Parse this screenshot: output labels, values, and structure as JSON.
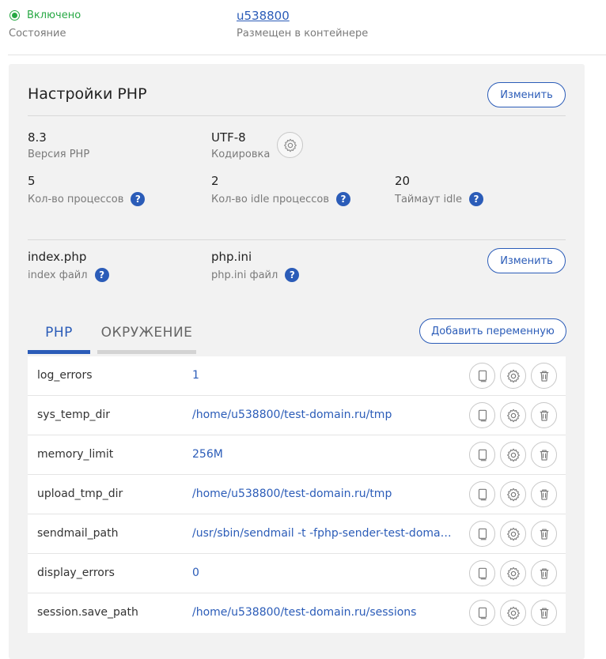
{
  "status": {
    "label": "Включено",
    "caption": "Состояние"
  },
  "container": {
    "user": "u538800",
    "caption": "Размещен в контейнере"
  },
  "php_settings": {
    "title": "Настройки PHP",
    "change_label": "Изменить",
    "version": {
      "value": "8.3",
      "label": "Версия PHP"
    },
    "encoding": {
      "value": "UTF-8",
      "label": "Кодировка",
      "icon": "gear-icon"
    },
    "processes": {
      "value": "5",
      "label": "Кол-во процессов"
    },
    "idle_processes": {
      "value": "2",
      "label": "Кол-во idle процессов"
    },
    "idle_timeout": {
      "value": "20",
      "label": "Таймаут idle"
    },
    "help_glyph": "?"
  },
  "files": {
    "index": {
      "value": "index.php",
      "label": "index файл"
    },
    "phpini": {
      "value": "php.ini",
      "label": "php.ini файл"
    },
    "change_label": "Изменить"
  },
  "tabs": {
    "php": "PHP",
    "env": "ОКРУЖЕНИЕ",
    "active": "PHP",
    "add_variable_label": "Добавить переменную"
  },
  "variables": [
    {
      "name": "log_errors",
      "value": "1"
    },
    {
      "name": "sys_temp_dir",
      "value": "/home/u538800/test-domain.ru/tmp"
    },
    {
      "name": "memory_limit",
      "value": "256M"
    },
    {
      "name": "upload_tmp_dir",
      "value": "/home/u538800/test-domain.ru/tmp"
    },
    {
      "name": "sendmail_path",
      "value": "/usr/sbin/sendmail -t -fphp-sender-test-domain.ru"
    },
    {
      "name": "display_errors",
      "value": "0"
    },
    {
      "name": "session.save_path",
      "value": "/home/u538800/test-domain.ru/sessions"
    }
  ],
  "row_actions": [
    "copy-icon",
    "gear-icon",
    "trash-icon"
  ],
  "colors": {
    "accent": "#2b5cb8",
    "success": "#27a844",
    "panel_bg": "#f2f2f2"
  }
}
